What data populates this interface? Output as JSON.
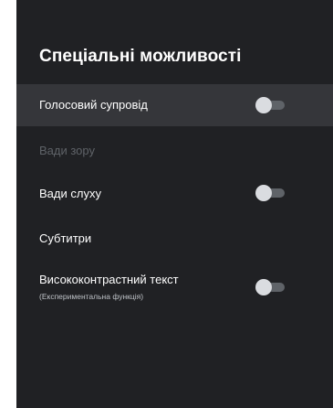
{
  "screen": {
    "title": "Спеціальні можливості"
  },
  "settings": [
    {
      "label": "Голосовий супровід",
      "toggle": true,
      "enabled": false,
      "focused": true
    },
    {
      "label": "Вади зору",
      "disabled": true
    },
    {
      "label": "Вади слуху",
      "toggle": true,
      "enabled": false
    },
    {
      "label": "Субтитри"
    },
    {
      "label": "Висококонтрастний текст",
      "sublabel": "(Експериментальна функція)",
      "toggle": true,
      "enabled": false
    }
  ],
  "colors": {
    "background": "#202124",
    "focused_row": "#35363a",
    "text_primary": "#ffffff",
    "text_disabled": "#5f6368",
    "toggle_thumb_off": "#dadce0",
    "toggle_track_off": "#5f6368"
  }
}
